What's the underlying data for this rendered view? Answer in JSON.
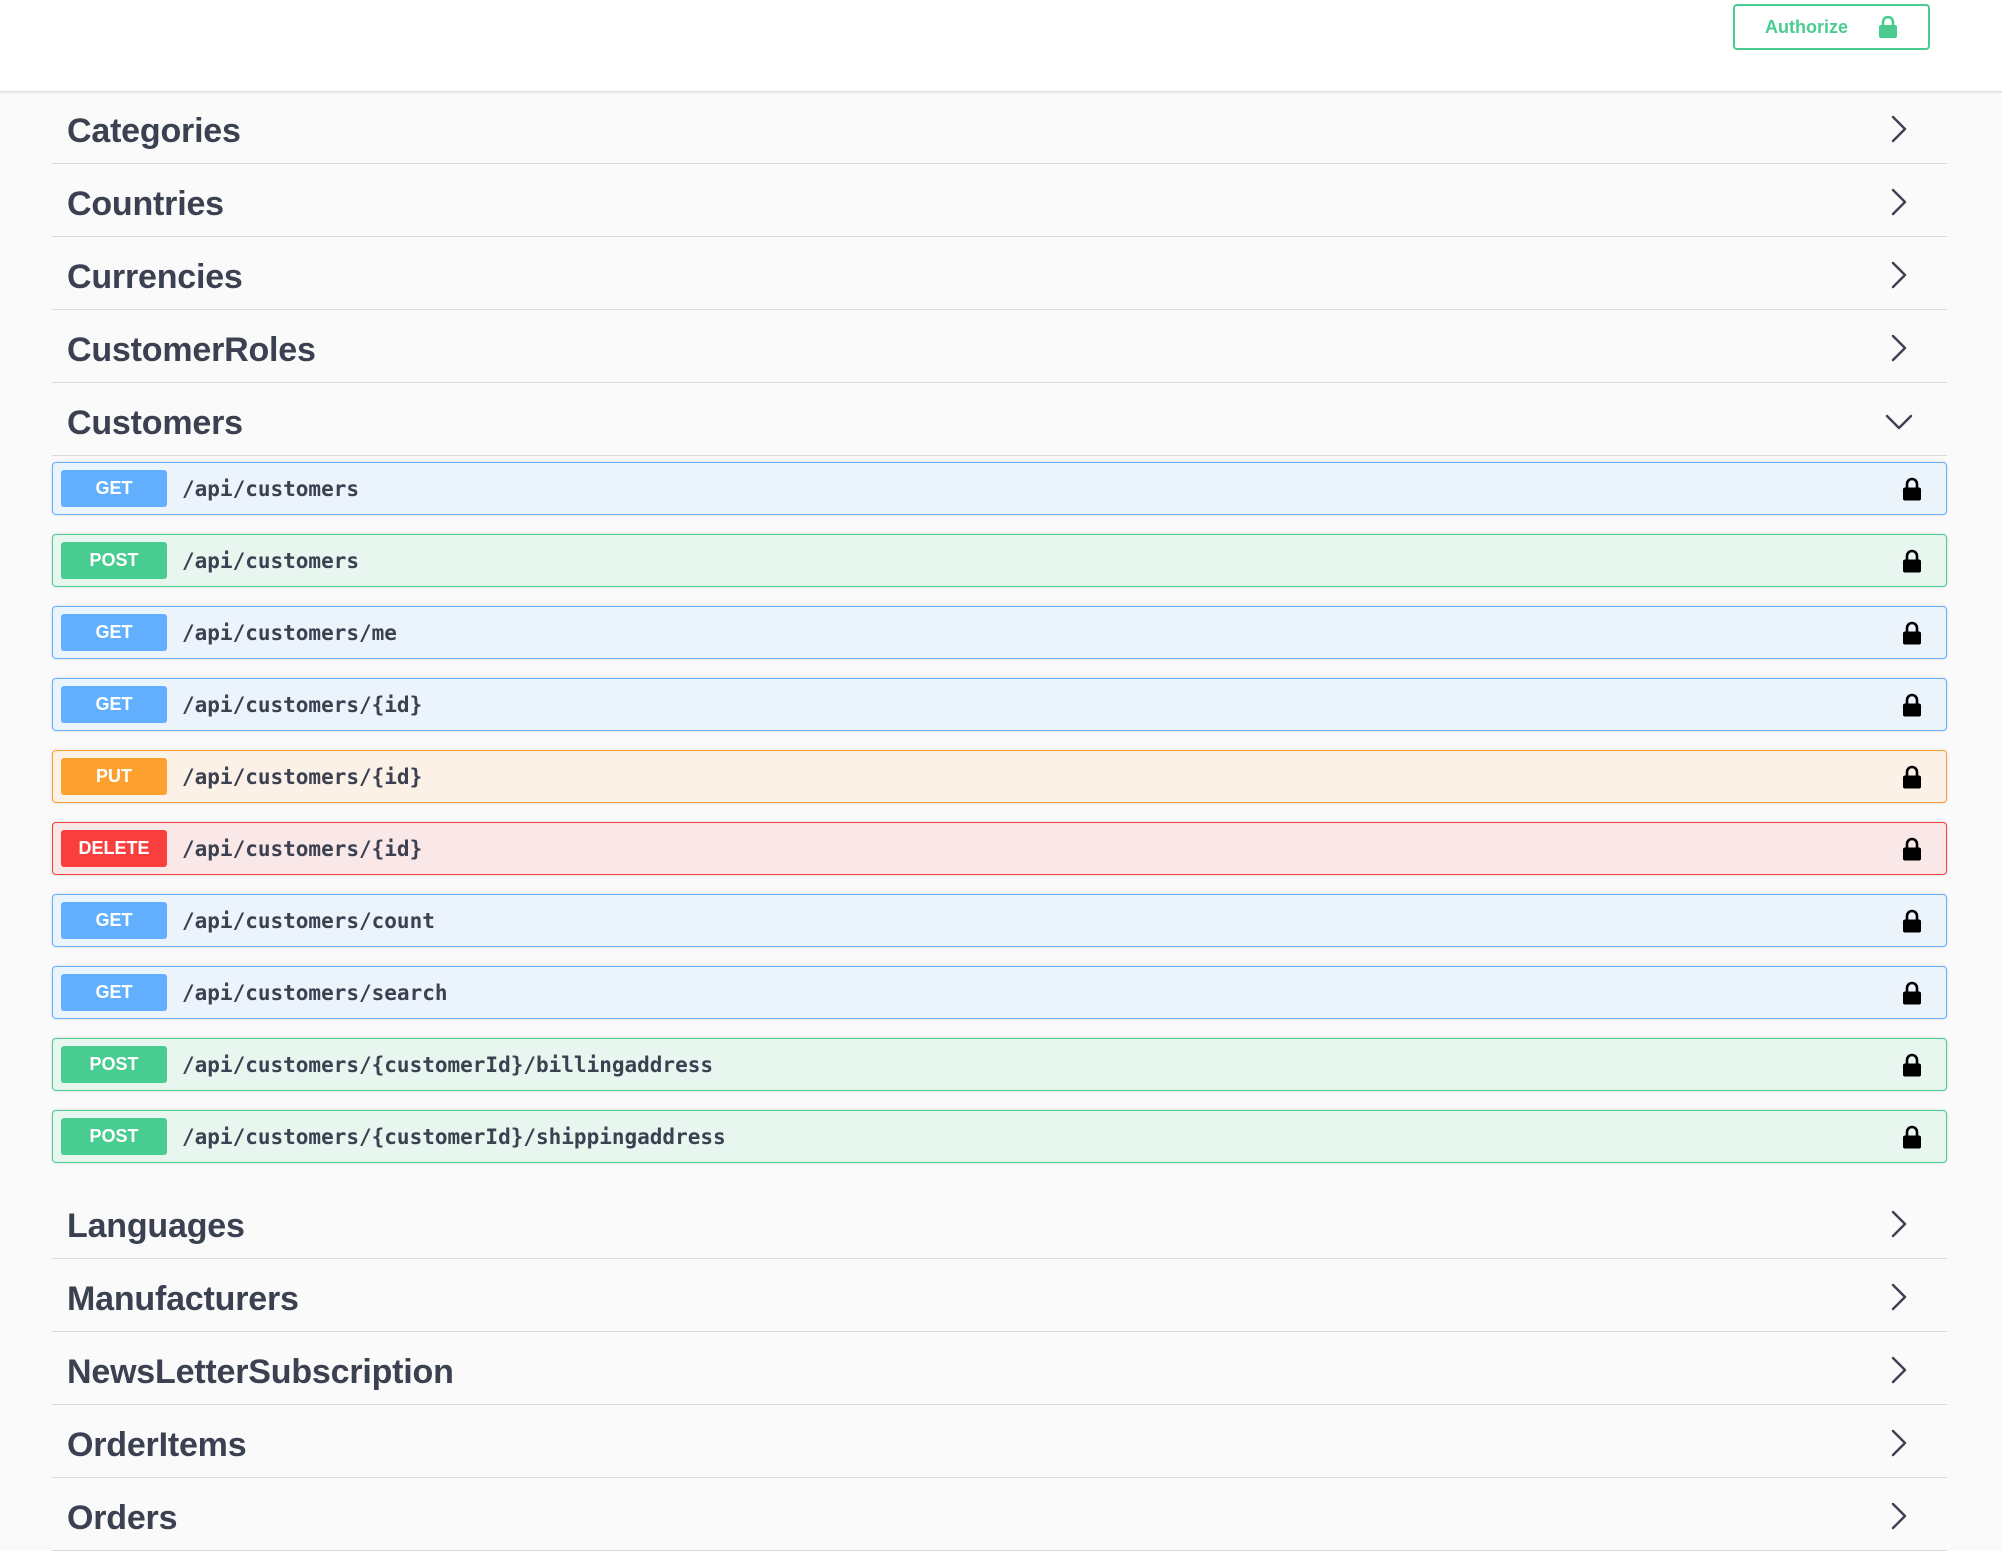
{
  "header": {
    "authorize_label": "Authorize",
    "authorize_icon": "lock-icon",
    "accent_color": "#49cc90"
  },
  "tags_before": [
    {
      "name": "Categories",
      "expanded": false
    },
    {
      "name": "Countries",
      "expanded": false
    },
    {
      "name": "Currencies",
      "expanded": false
    },
    {
      "name": "CustomerRoles",
      "expanded": false
    }
  ],
  "expanded_tag": {
    "name": "Customers",
    "expanded": true,
    "operations": [
      {
        "method": "GET",
        "path": "/api/customers"
      },
      {
        "method": "POST",
        "path": "/api/customers"
      },
      {
        "method": "GET",
        "path": "/api/customers/me"
      },
      {
        "method": "GET",
        "path": "/api/customers/{id}"
      },
      {
        "method": "PUT",
        "path": "/api/customers/{id}"
      },
      {
        "method": "DELETE",
        "path": "/api/customers/{id}"
      },
      {
        "method": "GET",
        "path": "/api/customers/count"
      },
      {
        "method": "GET",
        "path": "/api/customers/search"
      },
      {
        "method": "POST",
        "path": "/api/customers/{customerId}/billingaddress"
      },
      {
        "method": "POST",
        "path": "/api/customers/{customerId}/shippingaddress"
      }
    ]
  },
  "tags_after": [
    {
      "name": "Languages",
      "expanded": false
    },
    {
      "name": "Manufacturers",
      "expanded": false
    },
    {
      "name": "NewsLetterSubscription",
      "expanded": false
    },
    {
      "name": "OrderItems",
      "expanded": false
    },
    {
      "name": "Orders",
      "expanded": false
    }
  ],
  "method_colors": {
    "GET": "#61affe",
    "POST": "#49cc90",
    "PUT": "#fca130",
    "DELETE": "#f93e3e"
  }
}
